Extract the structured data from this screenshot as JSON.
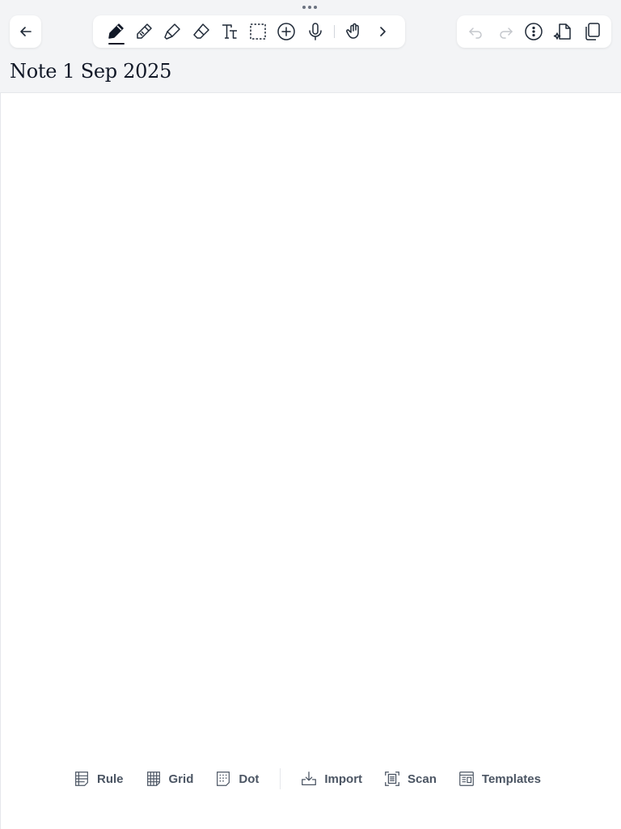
{
  "note": {
    "title": "Note 1 Sep 2025"
  },
  "toolbar": {
    "tools": [
      "fountain-pen",
      "pencil",
      "highlighter",
      "eraser",
      "text",
      "lasso",
      "add",
      "microphone",
      "touch-gesture",
      "more"
    ],
    "active_tool": "fountain-pen",
    "right_actions": [
      "undo",
      "redo",
      "info",
      "ai-page",
      "pages"
    ]
  },
  "bottom_bar": {
    "rule_label": "Rule",
    "grid_label": "Grid",
    "dot_label": "Dot",
    "import_label": "Import",
    "scan_label": "Scan",
    "templates_label": "Templates"
  },
  "colors": {
    "background": "#f3f4f6",
    "canvas": "#ffffff",
    "icon": "#1f2937",
    "icon_disabled": "#c4c7cc",
    "bottom_text": "#4b5563"
  }
}
